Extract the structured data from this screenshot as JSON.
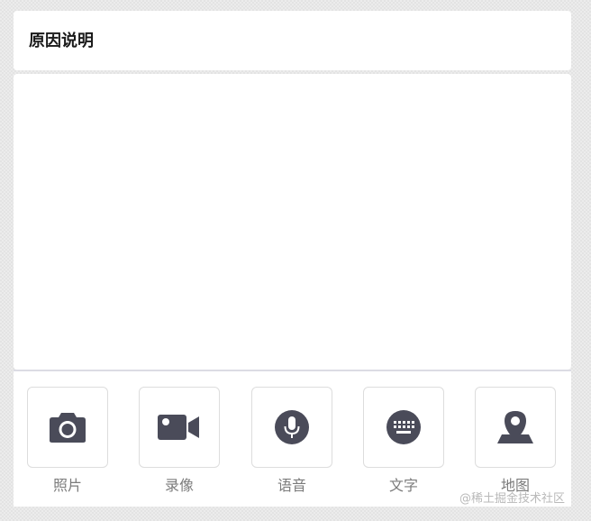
{
  "header": {
    "title": "原因说明"
  },
  "editor": {
    "placeholder": "",
    "value": ""
  },
  "toolbar": {
    "items": [
      {
        "label": "照片",
        "icon": "camera-icon"
      },
      {
        "label": "录像",
        "icon": "video-camera-icon"
      },
      {
        "label": "语音",
        "icon": "microphone-icon"
      },
      {
        "label": "文字",
        "icon": "keyboard-icon"
      },
      {
        "label": "地图",
        "icon": "map-pin-icon"
      }
    ]
  },
  "watermark": {
    "text": "@稀土掘金技术社区"
  },
  "colors": {
    "icon": "#4a4b59",
    "label": "#7b7b7b",
    "title": "#1a1a1a"
  }
}
